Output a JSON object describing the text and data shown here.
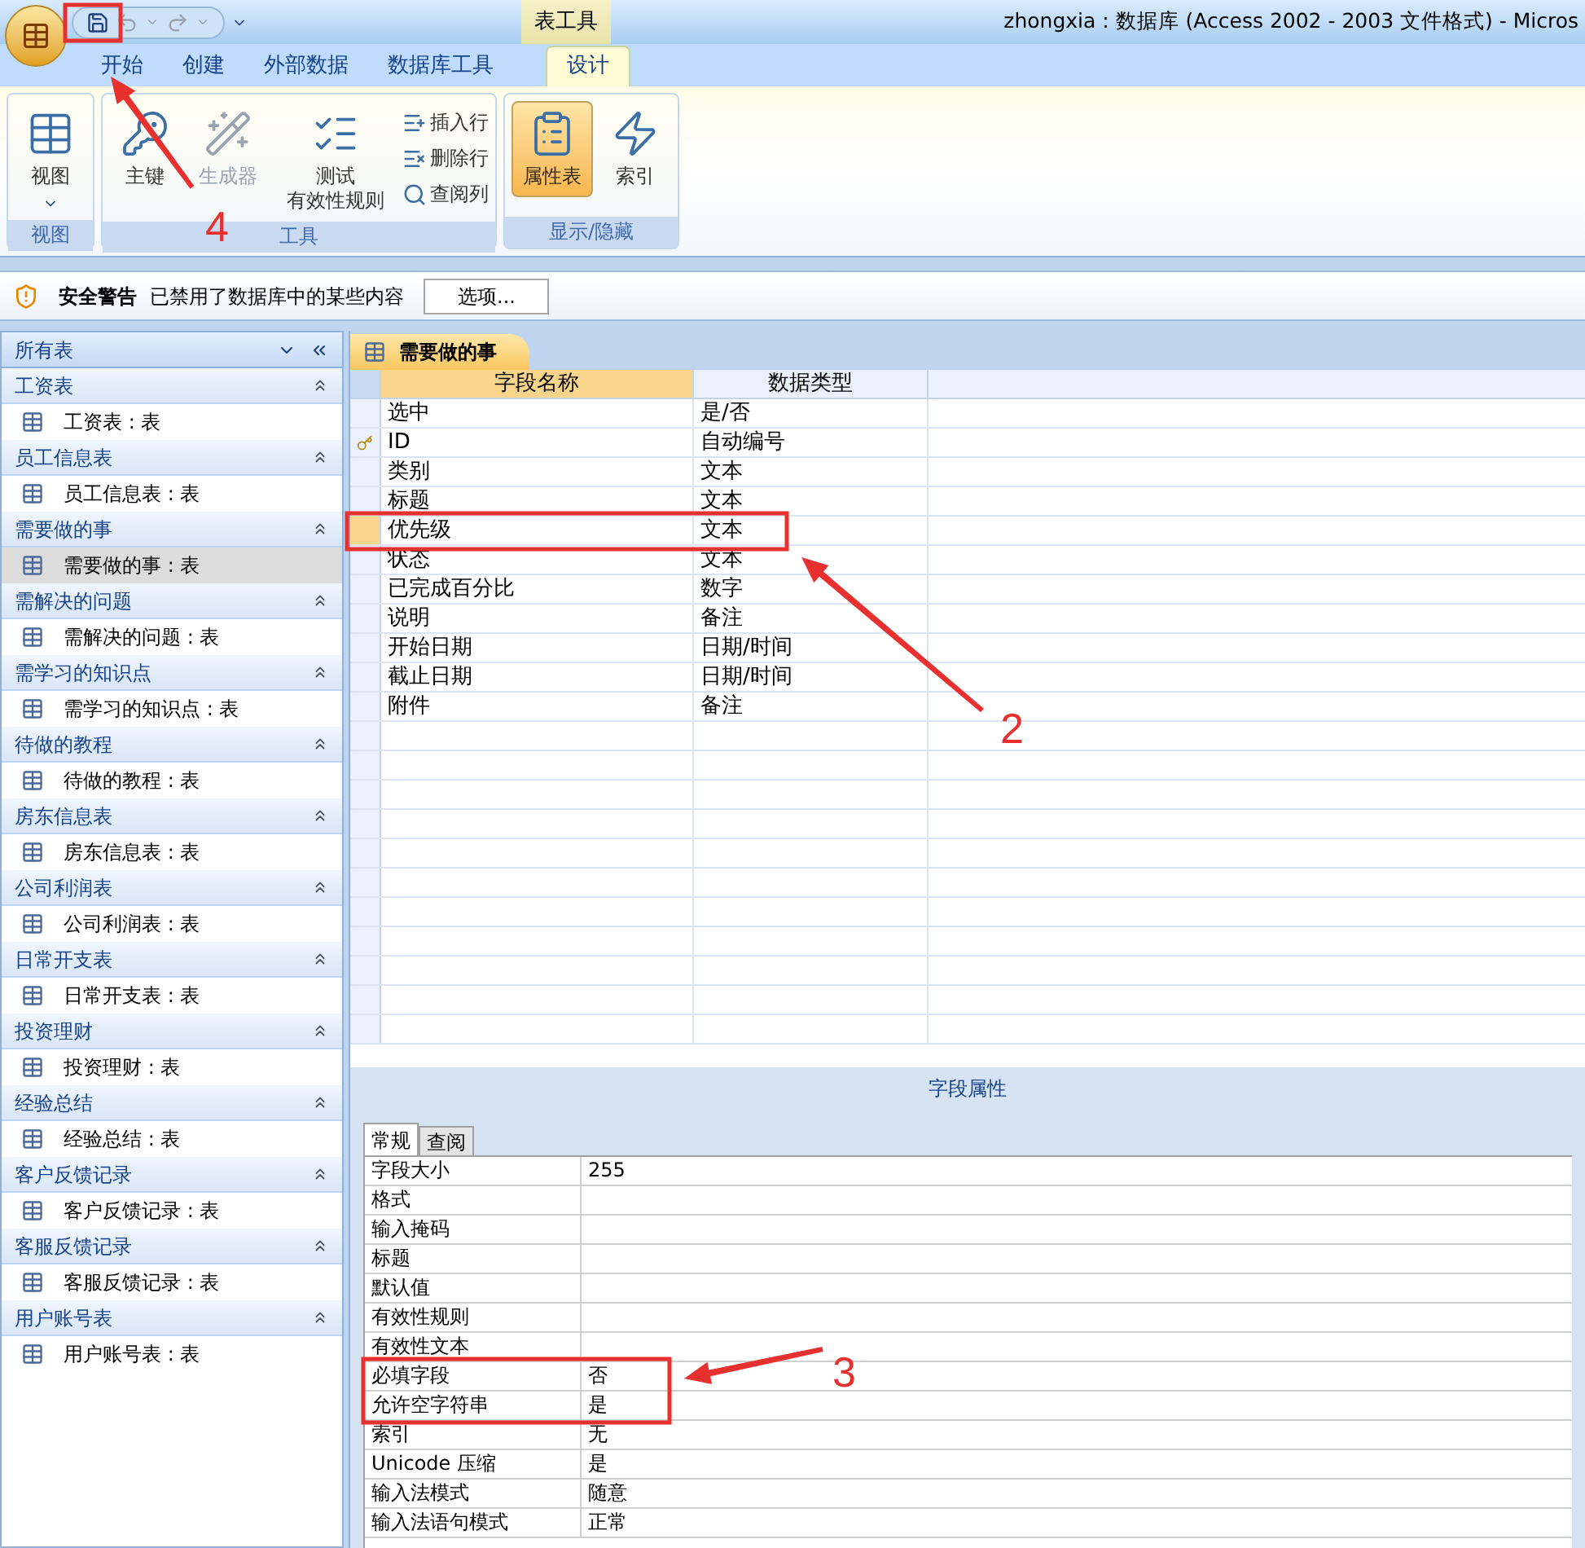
{
  "title_bar": {
    "contextual_group": "表工具",
    "title": "zhongxia : 数据库 (Access 2002 - 2003 文件格式) - Micros"
  },
  "tabs": [
    {
      "label": "开始",
      "selected": false
    },
    {
      "label": "创建",
      "selected": false
    },
    {
      "label": "外部数据",
      "selected": false
    },
    {
      "label": "数据库工具",
      "selected": false
    },
    {
      "label": "设计",
      "selected": true
    }
  ],
  "ribbon_groups": [
    {
      "label": "视图",
      "buttons": [
        {
          "kind": "large",
          "label_lines": [
            "视图"
          ],
          "dropdown": true,
          "disabled": false,
          "selected": false
        }
      ]
    },
    {
      "label": "工具",
      "buttons": [
        {
          "kind": "large",
          "label_lines": [
            "主键"
          ],
          "disabled": false,
          "selected": false
        },
        {
          "kind": "large",
          "label_lines": [
            "生成器"
          ],
          "disabled": true,
          "selected": false
        },
        {
          "kind": "large",
          "label_lines": [
            "测试",
            "有效性规则"
          ],
          "disabled": false,
          "selected": false
        },
        {
          "kind": "small",
          "label_lines": [
            "插入行"
          ],
          "disabled": false,
          "selected": false
        },
        {
          "kind": "small",
          "label_lines": [
            "删除行"
          ],
          "disabled": false,
          "selected": false
        },
        {
          "kind": "small",
          "label_lines": [
            "查阅列"
          ],
          "disabled": false,
          "selected": false
        }
      ]
    },
    {
      "label": "显示/隐藏",
      "buttons": [
        {
          "kind": "large",
          "label_lines": [
            "属性表"
          ],
          "disabled": false,
          "selected": true
        },
        {
          "kind": "large",
          "label_lines": [
            "索引"
          ],
          "disabled": false,
          "selected": false
        }
      ]
    }
  ],
  "security_bar": {
    "title": "安全警告",
    "message": "已禁用了数据库中的某些内容",
    "button": "选项..."
  },
  "nav_pane": {
    "title": "所有表",
    "groups": [
      {
        "label": "工资表",
        "items": [
          {
            "label": "工资表 : 表",
            "selected": false
          }
        ]
      },
      {
        "label": "员工信息表",
        "items": [
          {
            "label": "员工信息表 : 表",
            "selected": false
          }
        ]
      },
      {
        "label": "需要做的事",
        "items": [
          {
            "label": "需要做的事 : 表",
            "selected": true
          }
        ]
      },
      {
        "label": "需解决的问题",
        "items": [
          {
            "label": "需解决的问题 : 表",
            "selected": false
          }
        ]
      },
      {
        "label": "需学习的知识点",
        "items": [
          {
            "label": "需学习的知识点 : 表",
            "selected": false
          }
        ]
      },
      {
        "label": "待做的教程",
        "items": [
          {
            "label": "待做的教程 : 表",
            "selected": false
          }
        ]
      },
      {
        "label": "房东信息表",
        "items": [
          {
            "label": "房东信息表 : 表",
            "selected": false
          }
        ]
      },
      {
        "label": "公司利润表",
        "items": [
          {
            "label": "公司利润表 : 表",
            "selected": false
          }
        ]
      },
      {
        "label": "日常开支表",
        "items": [
          {
            "label": "日常开支表 : 表",
            "selected": false
          }
        ]
      },
      {
        "label": "投资理财",
        "items": [
          {
            "label": "投资理财 : 表",
            "selected": false
          }
        ]
      },
      {
        "label": "经验总结",
        "items": [
          {
            "label": "经验总结 : 表",
            "selected": false
          }
        ]
      },
      {
        "label": "客户反馈记录",
        "items": [
          {
            "label": "客户反馈记录 : 表",
            "selected": false
          }
        ]
      },
      {
        "label": "客服反馈记录",
        "items": [
          {
            "label": "客服反馈记录 : 表",
            "selected": false
          }
        ]
      },
      {
        "label": "用户账号表",
        "items": [
          {
            "label": "用户账号表 : 表",
            "selected": false
          }
        ]
      }
    ]
  },
  "document_tab": {
    "label": "需要做的事"
  },
  "field_grid": {
    "columns": [
      {
        "label": "字段名称",
        "selected": true
      },
      {
        "label": "数据类型",
        "selected": false
      }
    ],
    "rows": [
      {
        "name": "选中",
        "type": "是/否",
        "primary_key": false,
        "selected": false
      },
      {
        "name": "ID",
        "type": "自动编号",
        "primary_key": true,
        "selected": false
      },
      {
        "name": "类别",
        "type": "文本",
        "primary_key": false,
        "selected": false
      },
      {
        "name": "标题",
        "type": "文本",
        "primary_key": false,
        "selected": false
      },
      {
        "name": "优先级",
        "type": "文本",
        "primary_key": false,
        "selected": true
      },
      {
        "name": "状态",
        "type": "文本",
        "primary_key": false,
        "selected": false
      },
      {
        "name": "已完成百分比",
        "type": "数字",
        "primary_key": false,
        "selected": false
      },
      {
        "name": "说明",
        "type": "备注",
        "primary_key": false,
        "selected": false
      },
      {
        "name": "开始日期",
        "type": "日期/时间",
        "primary_key": false,
        "selected": false
      },
      {
        "name": "截止日期",
        "type": "日期/时间",
        "primary_key": false,
        "selected": false
      },
      {
        "name": "附件",
        "type": "备注",
        "primary_key": false,
        "selected": false
      }
    ]
  },
  "field_properties": {
    "title": "字段属性",
    "tabs": [
      {
        "label": "常规",
        "selected": true
      },
      {
        "label": "查阅",
        "selected": false
      }
    ],
    "rows": [
      {
        "label": "字段大小",
        "value": "255"
      },
      {
        "label": "格式"
      },
      {
        "label": "输入掩码"
      },
      {
        "label": "标题"
      },
      {
        "label": "默认值"
      },
      {
        "label": "有效性规则"
      },
      {
        "label": "有效性文本"
      },
      {
        "label": "必填字段",
        "value": "否"
      },
      {
        "label": "允许空字符串",
        "value": "是"
      },
      {
        "label": "索引",
        "value": "无"
      },
      {
        "label": "Unicode 压缩",
        "value": "是"
      },
      {
        "label": "输入法模式",
        "value": "随意"
      },
      {
        "label": "输入法语句模式",
        "value": "正常"
      }
    ]
  },
  "annotations": [
    {
      "label": "4"
    },
    {
      "label": "2"
    },
    {
      "label": "3"
    }
  ]
}
